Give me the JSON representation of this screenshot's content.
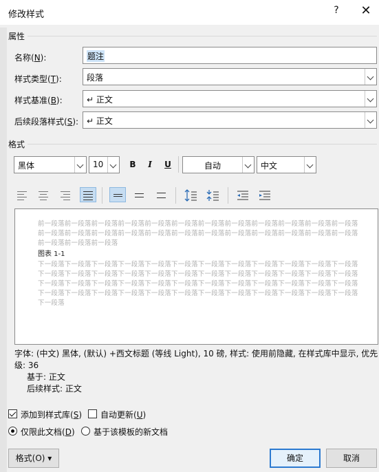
{
  "dialog": {
    "title": "修改样式",
    "help": "?",
    "close": "✕"
  },
  "properties": {
    "heading": "属性",
    "name": {
      "label": "名称(",
      "key": "N",
      "suffix": "):",
      "value": "题注"
    },
    "style_type": {
      "label": "样式类型(",
      "key": "T",
      "suffix": "):",
      "value": "段落"
    },
    "based_on": {
      "label": "样式基准(",
      "key": "B",
      "suffix": "):",
      "value": "↵ 正文"
    },
    "next_style": {
      "label": "后续段落样式(",
      "key": "S",
      "suffix": "):",
      "value": "↵ 正文"
    }
  },
  "format": {
    "heading": "格式",
    "font": "黑体",
    "size": "10",
    "bold": "B",
    "italic": "I",
    "underline": "U",
    "color": "自动",
    "script": "中文"
  },
  "preview": {
    "prev_lines": [
      "前一段落前一段落前一段落前一段落前一段落前一段落前一段落前一段落前一段落前一段落前一段落前一段落",
      "前一段落前一段落前一段落前一段落前一段落前一段落前一段落前一段落前一段落前一段落前一段落前一段落",
      "前一段落前一段落前一段落"
    ],
    "sample": "图表 1-1",
    "next_lines": [
      "下一段落下一段落下一段落下一段落下一段落下一段落下一段落下一段落下一段落下一段落下一段落下一段落",
      "下一段落下一段落下一段落下一段落下一段落下一段落下一段落下一段落下一段落下一段落下一段落下一段落",
      "下一段落下一段落下一段落下一段落下一段落下一段落下一段落下一段落下一段落下一段落下一段落下一段落",
      "下一段落下一段落下一段落下一段落下一段落下一段落下一段落下一段落下一段落下一段落下一段落下一段落",
      "下一段落"
    ]
  },
  "description": {
    "line1": "字体: (中文) 黑体, (默认) +西文标题 (等线 Light), 10 磅, 样式: 使用前隐藏, 在样式库中显示, 优先",
    "line2": "级: 36",
    "line3": "基于: 正文",
    "line4": "后续样式: 正文"
  },
  "options": {
    "add_to_gallery": {
      "label": "添加到样式库(",
      "key": "S",
      "suffix": ")",
      "checked": true
    },
    "auto_update": {
      "label": "自动更新(",
      "key": "U",
      "suffix": ")",
      "checked": false
    },
    "only_this_doc": {
      "label": "仅限此文档(",
      "key": "D",
      "suffix": ")",
      "selected": true
    },
    "new_docs": {
      "label": "基于该模板的新文档",
      "selected": false
    }
  },
  "buttons": {
    "format": "格式(O) ▾",
    "ok": "确定",
    "cancel": "取消"
  },
  "colors": {
    "accent": "#2b79d0",
    "selection": "#cde3f7",
    "active_tool": "#c6ddf2"
  }
}
